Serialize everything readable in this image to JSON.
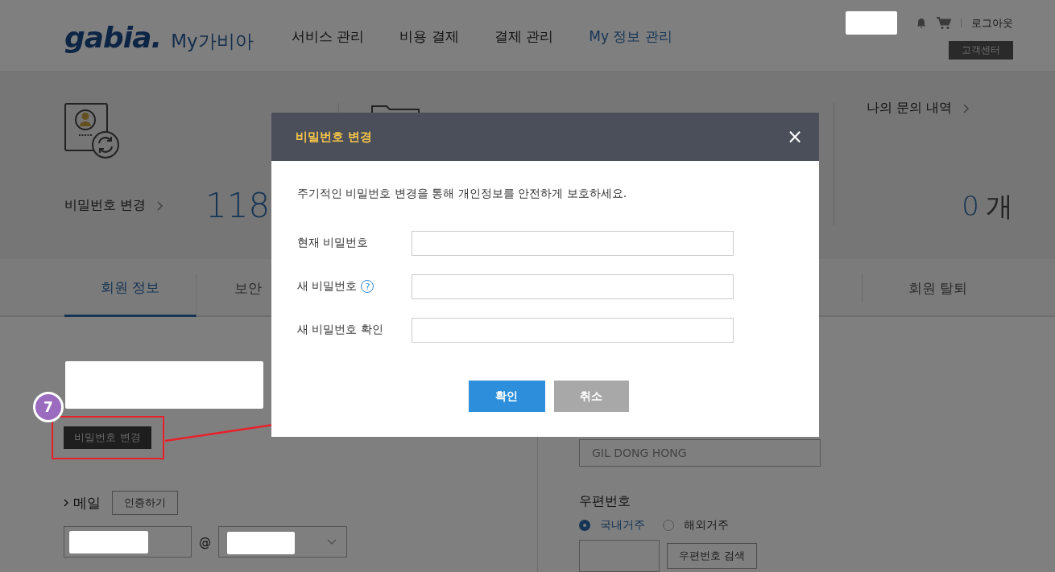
{
  "header": {
    "logo": "gabia.",
    "service_name": "My가비아",
    "nav": [
      {
        "label": "서비스 관리",
        "selected": false
      },
      {
        "label": "비용 결제",
        "selected": false
      },
      {
        "label": "결제 관리",
        "selected": false
      },
      {
        "label": "My 정보 관리",
        "selected": true
      }
    ],
    "logout": "로그아웃",
    "support_button": "고객센터"
  },
  "summary": {
    "password_label": "비밀번호 변경",
    "count": "118",
    "inquiries_label": "나의 문의 내역",
    "inquiries_count": "0",
    "inquiries_unit": "개"
  },
  "tabs": [
    {
      "label": "회원 정보",
      "selected": true
    },
    {
      "label": "보안",
      "selected": false
    },
    {
      "label": "회원 탈퇴",
      "selected": false
    }
  ],
  "form": {
    "change_password_button": "비밀번호 변경",
    "email_label": "메일",
    "verify_button": "인증하기",
    "at_sign": "@",
    "english_name_placeholder": "GIL DONG HONG",
    "postal_label": "우편번호",
    "residence": [
      {
        "label": "국내거주",
        "selected": true
      },
      {
        "label": "해외거주",
        "selected": false
      }
    ],
    "postal_search_button": "우편번호 검색"
  },
  "annotation": {
    "step": "7"
  },
  "dialog": {
    "title": "비밀번호 변경",
    "close": "×",
    "description": "주기적인 비밀번호 변경을 통해 개인정보를 안전하게 보호하세요.",
    "fields": [
      {
        "label": "현재 비밀번호"
      },
      {
        "label": "새 비밀번호",
        "help": "?"
      },
      {
        "label": "새 비밀번호 확인"
      }
    ],
    "buttons": [
      {
        "label": "확인",
        "kind": "primary"
      },
      {
        "label": "취소",
        "kind": "secondary"
      }
    ]
  }
}
